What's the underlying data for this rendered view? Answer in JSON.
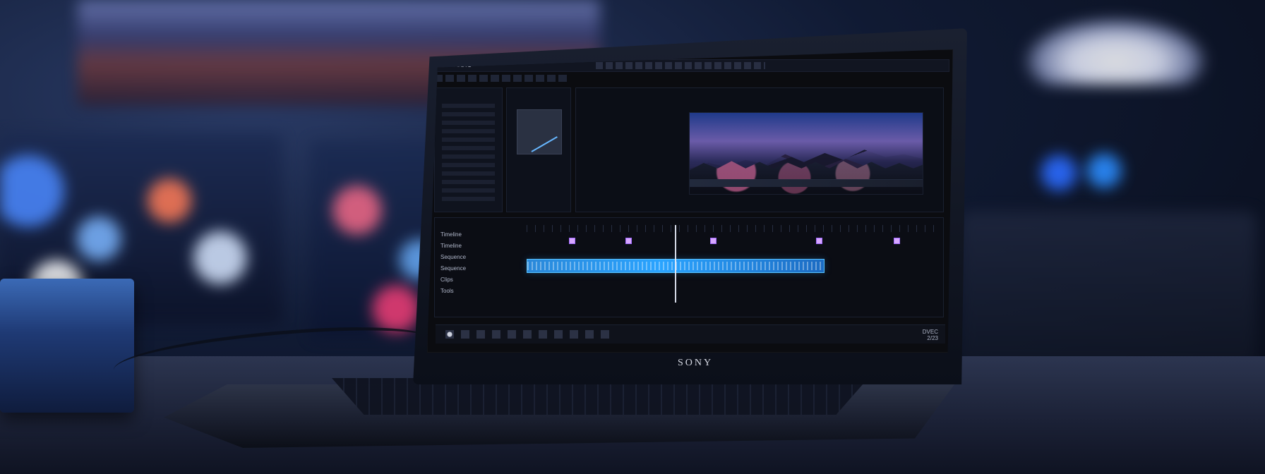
{
  "scene": {
    "brand_text": "SONY",
    "accent_colors": {
      "screen_blue": "#2aa4ff",
      "ui_dark": "#0b0d14",
      "ui_text": "#c8ccd8"
    }
  },
  "editor": {
    "title": "E STUDIO",
    "panel_left_label": "",
    "panel_source_label": "",
    "viewer_label": "",
    "timeline_labels": [
      "Timeline",
      "Timeline",
      "Sequence",
      "Sequence",
      "Clips",
      "Tools"
    ],
    "topbar_right": "",
    "taskbar_right_top": "DVEC",
    "taskbar_right_bottom": "2/23"
  }
}
